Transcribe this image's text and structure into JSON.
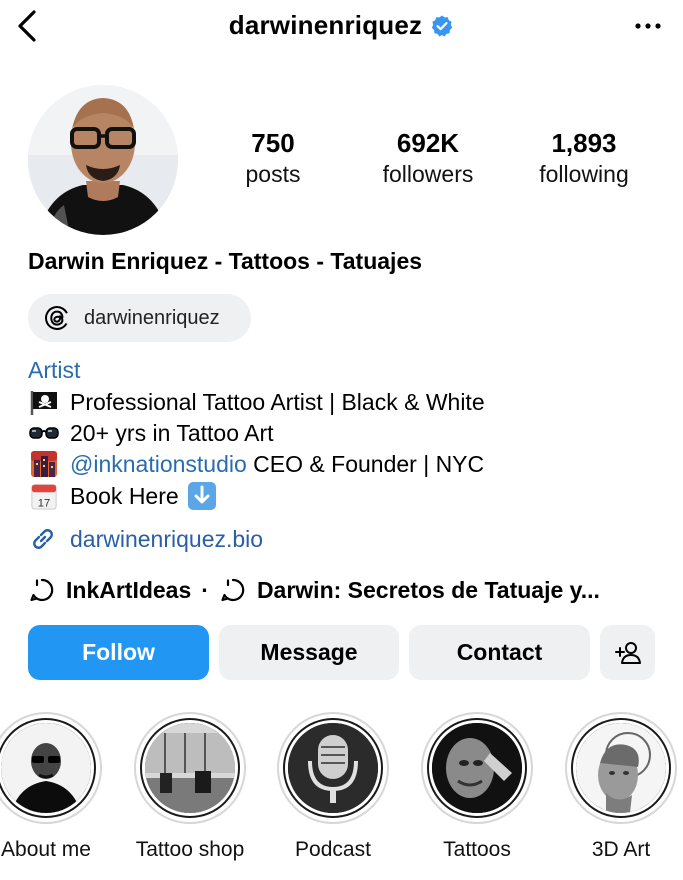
{
  "header": {
    "username": "darwinenriquez",
    "verified_color": "#3797f0"
  },
  "stats": {
    "posts_value": "750",
    "posts_label": "posts",
    "followers_value": "692K",
    "followers_label": "followers",
    "following_value": "1,893",
    "following_label": "following"
  },
  "profile": {
    "full_name": "Darwin Enriquez - Tattoos - Tatuajes",
    "threads_handle": "darwinenriquez",
    "category": "Artist",
    "bio": {
      "line1": "Professional Tattoo Artist | Black & White",
      "line2": "20+ yrs in Tattoo Art",
      "line3_mention": "@inknationstudio",
      "line3_rest": " CEO & Founder | NYC",
      "line4": "Book Here",
      "calendar_day": "17"
    },
    "link": "darwinenriquez.bio",
    "threads_links": {
      "first": "InkArtIdeas",
      "separator": "·",
      "second": "Darwin: Secretos de Tatuaje y..."
    }
  },
  "actions": {
    "follow": "Follow",
    "message": "Message",
    "contact": "Contact",
    "follow_color": "#2196f3"
  },
  "highlights": [
    {
      "label": "About me"
    },
    {
      "label": "Tattoo shop"
    },
    {
      "label": "Podcast"
    },
    {
      "label": "Tattoos"
    },
    {
      "label": "3D Art"
    }
  ],
  "icons": {
    "back": "back-chevron-icon",
    "verified": "verified-badge-icon",
    "more": "more-options-icon",
    "threads": "threads-icon",
    "link": "link-icon",
    "add_user": "add-user-icon"
  }
}
